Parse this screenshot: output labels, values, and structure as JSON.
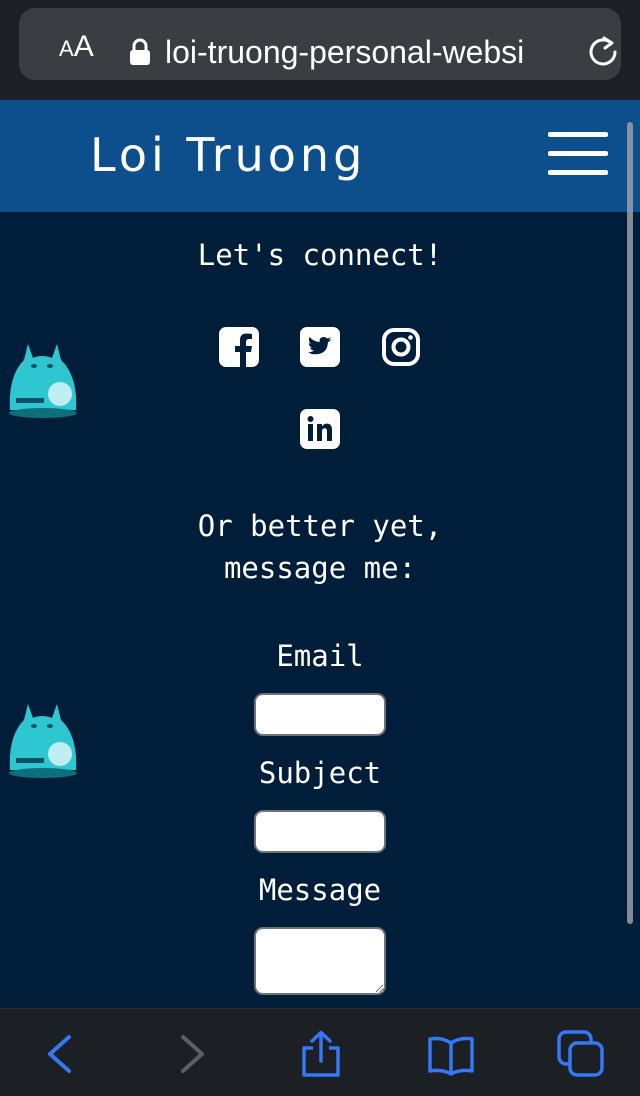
{
  "browser": {
    "text_size_label_small": "A",
    "text_size_label_large": "A",
    "url": "loi-truong-personal-websi",
    "icons": [
      "lock-icon",
      "reload-icon"
    ],
    "toolbar": [
      "back-icon",
      "forward-icon",
      "share-icon",
      "bookmarks-icon",
      "tabs-icon"
    ],
    "accent_color": "#3478f6"
  },
  "site": {
    "title": "Loi Truong",
    "menu_icon": "hamburger-menu-icon",
    "nav_color": "#0d4f8c",
    "background_color": "#001d3a"
  },
  "contact": {
    "heading": "Let's connect!",
    "social_icons": [
      "facebook-icon",
      "twitter-icon",
      "instagram-icon",
      "linkedin-icon"
    ],
    "message_heading_line1": "Or better yet,",
    "message_heading_line2": "message me:",
    "form": {
      "email_label": "Email",
      "email_value": "",
      "subject_label": "Subject",
      "subject_value": "",
      "message_label": "Message",
      "message_value": ""
    }
  }
}
